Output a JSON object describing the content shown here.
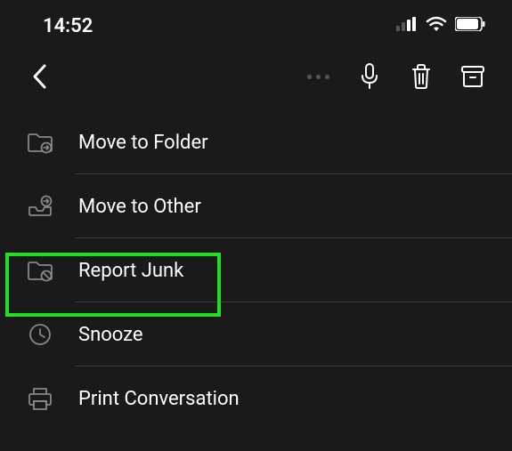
{
  "status": {
    "time": "14:52"
  },
  "menu": {
    "items": [
      {
        "label": "Move to Folder",
        "icon": "folder-move-icon"
      },
      {
        "label": "Move to Other",
        "icon": "inbox-move-icon"
      },
      {
        "label": "Report Junk",
        "icon": "folder-junk-icon"
      },
      {
        "label": "Snooze",
        "icon": "clock-icon"
      },
      {
        "label": "Print Conversation",
        "icon": "printer-icon"
      }
    ]
  },
  "highlight": {
    "target_index": 2,
    "color": "#22dd22"
  },
  "colors": {
    "background": "#1a1a1a",
    "text": "#ffffff",
    "icon_muted": "#888888",
    "divider": "#3a3a3a"
  }
}
